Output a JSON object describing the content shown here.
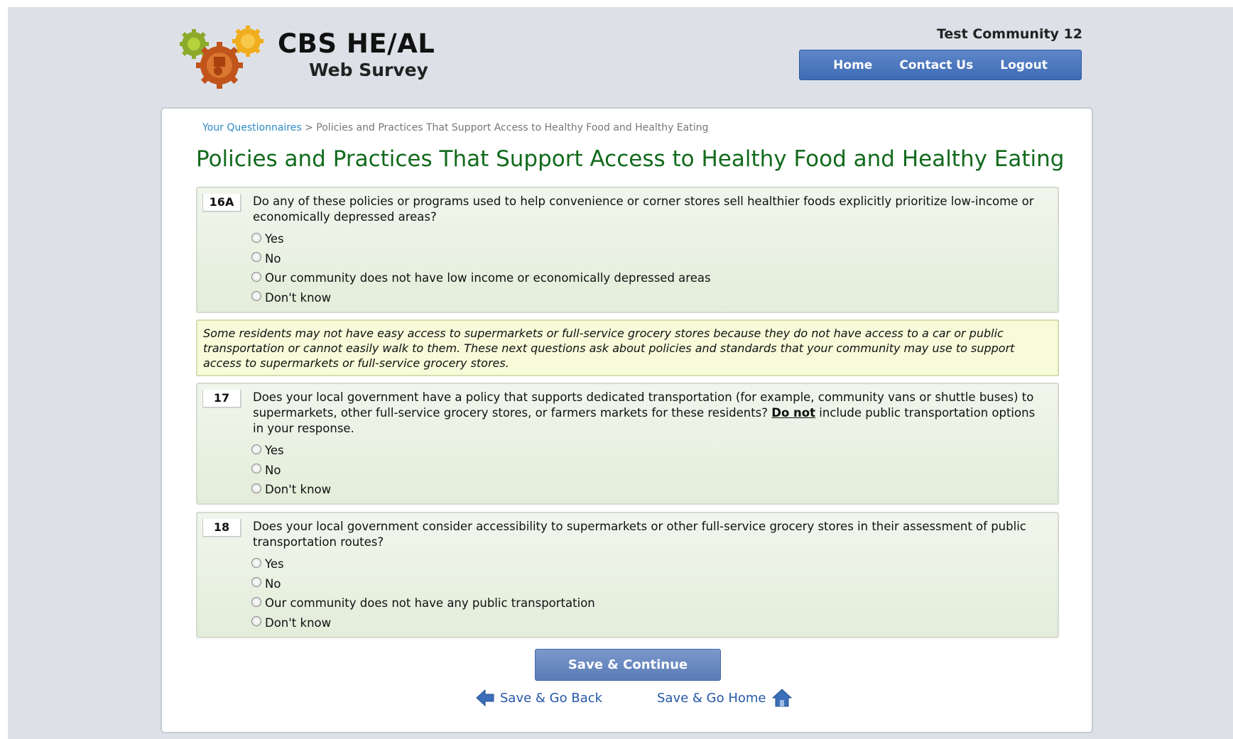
{
  "header": {
    "logo_title": "CBS HE/AL",
    "logo_subtitle": "Web Survey",
    "community_name": "Test Community 12",
    "nav": [
      "Home",
      "Contact Us",
      "Logout"
    ]
  },
  "breadcrumb": {
    "link": "Your Questionnaires",
    "separator": ">",
    "current": "Policies and Practices That Support Access to Healthy Food and Healthy Eating"
  },
  "page_title": "Policies and Practices That Support Access to Healthy Food and Healthy Eating",
  "questions": [
    {
      "number": "16A",
      "text": "Do any of these policies or programs used to help convenience or corner stores sell healthier foods explicitly prioritize low-income or economically depressed areas?",
      "options": [
        "Yes",
        "No",
        "Our community does not have low income or economically depressed areas",
        "Don't know"
      ]
    },
    {
      "number": "17",
      "text_before": "Does your local government have a policy that supports dedicated transportation (for example, community vans or shuttle buses) to supermarkets, other full-service grocery stores, or farmers markets for these residents?",
      "text_emphasis": "Do not",
      "text_after": "include public transportation options in your response.",
      "options": [
        "Yes",
        "No",
        "Don't know"
      ]
    },
    {
      "number": "18",
      "text": "Does your local government consider accessibility to supermarkets or other full-service grocery stores in their assessment of public transportation routes?",
      "options": [
        "Yes",
        "No",
        "Our community does not have any public transportation",
        "Don't know"
      ]
    }
  ],
  "note": "Some residents may not have easy access to supermarkets or full-service grocery stores because they do not have access to a car or public transportation or cannot easily walk to them. These next questions ask about policies and standards that your community may use to support access to supermarkets or full-service grocery stores.",
  "actions": {
    "save_continue": "Save & Continue",
    "save_back": "Save & Go Back",
    "save_home": "Save & Go Home"
  },
  "colors": {
    "title_green": "#126a1c",
    "nav_blue": "#3d6bb5",
    "link_blue": "#2557a7",
    "breadcrumb_link": "#2d8ac6"
  }
}
